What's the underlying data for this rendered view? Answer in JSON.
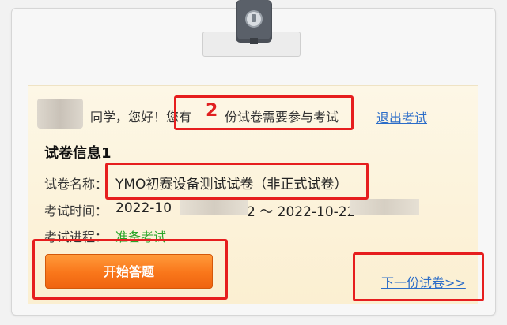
{
  "greeting": {
    "hello": "同学，您好！您有",
    "count": "2",
    "suffix": "份试卷需要参与考试",
    "logout_label": "退出考试"
  },
  "paper": {
    "section_title": "试卷信息1",
    "name_label": "试卷名称：",
    "name_value": "YMO初赛设备测试试卷（非正式试卷）",
    "time_label": "考试时间：",
    "time_start": "2022-10",
    "time_separator": "2 ～ 2022-10-22",
    "progress_label": "考试进程：",
    "progress_value": "准备考试"
  },
  "actions": {
    "start_label": "开始答题",
    "next_label": "下一份试卷>>"
  },
  "colors": {
    "highlight": "#e61e1e",
    "accent_orange": "#f9761a",
    "link_blue": "#2a6cc8",
    "status_green": "#2aa52a",
    "count_red": "#e02020"
  }
}
